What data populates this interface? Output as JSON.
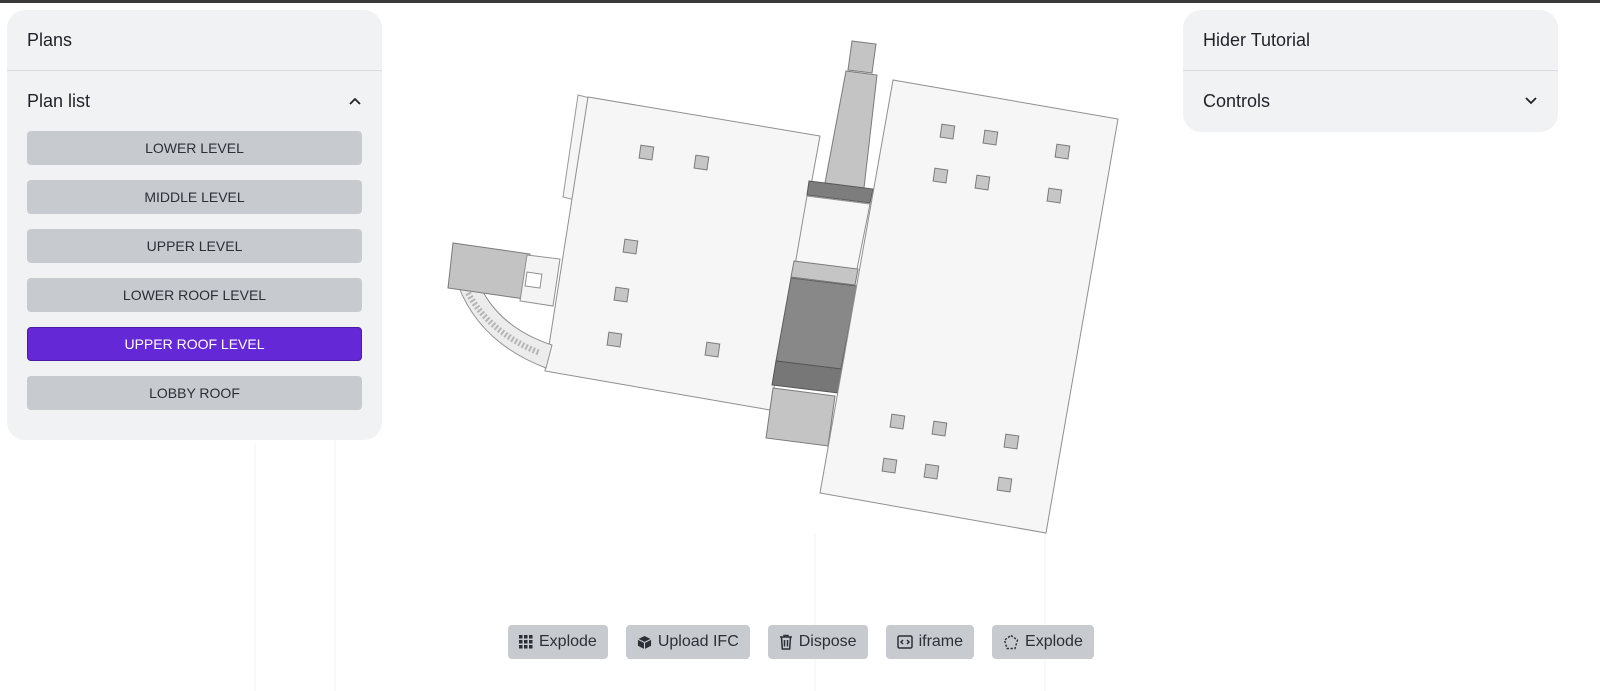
{
  "plans_panel": {
    "title": "Plans",
    "plan_list_label": "Plan list",
    "plans": [
      {
        "label": "LOWER LEVEL",
        "active": false
      },
      {
        "label": "MIDDLE LEVEL",
        "active": false
      },
      {
        "label": "UPPER LEVEL",
        "active": false
      },
      {
        "label": "LOWER ROOF LEVEL",
        "active": false
      },
      {
        "label": "UPPER ROOF LEVEL",
        "active": true
      },
      {
        "label": "LOBBY ROOF",
        "active": false
      }
    ]
  },
  "tutorial_panel": {
    "title": "Hider Tutorial",
    "controls_label": "Controls"
  },
  "toolbar": {
    "buttons": [
      {
        "label": "Explode",
        "icon": "grid-icon"
      },
      {
        "label": "Upload IFC",
        "icon": "cube-icon"
      },
      {
        "label": "Dispose",
        "icon": "trash-icon"
      },
      {
        "label": "iframe",
        "icon": "code-frame-icon"
      },
      {
        "label": "Explode",
        "icon": "dashed-polygon-icon"
      }
    ]
  },
  "colors": {
    "accent": "#6528d7",
    "button_bg": "#c7cbd0",
    "panel_bg": "#f1f2f4"
  }
}
